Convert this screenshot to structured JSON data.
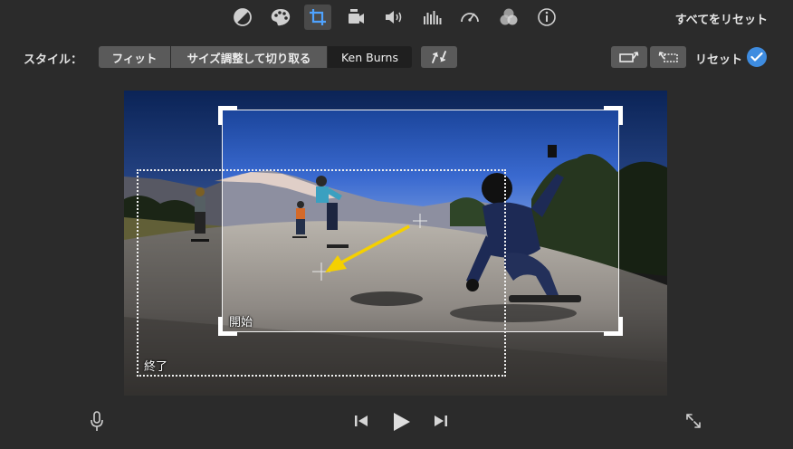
{
  "toolbar": {
    "tools": [
      {
        "name": "color-balance-icon",
        "active": false
      },
      {
        "name": "color-correction-icon",
        "active": false
      },
      {
        "name": "crop-icon",
        "active": true
      },
      {
        "name": "stabilization-icon",
        "active": false
      },
      {
        "name": "volume-icon",
        "active": false
      },
      {
        "name": "noise-reduction-icon",
        "active": false
      },
      {
        "name": "speed-icon",
        "active": false
      },
      {
        "name": "clip-filter-icon",
        "active": false
      },
      {
        "name": "info-icon",
        "active": false
      }
    ],
    "reset_all_label": "すべてをリセット"
  },
  "style_row": {
    "label": "スタイル：",
    "options": {
      "fit": "フィット",
      "crop": "サイズ調整して切り取る",
      "ken_burns": "Ken Burns"
    },
    "selected": "Ken Burns",
    "reset_label": "リセット",
    "accent_color": "#3e8ce0"
  },
  "viewer": {
    "start_label": "開始",
    "end_label": "終了",
    "arrow_color": "#f5d000"
  },
  "playback": {
    "icons": [
      "microphone-icon",
      "previous-icon",
      "play-icon",
      "next-icon",
      "fullscreen-icon"
    ]
  }
}
